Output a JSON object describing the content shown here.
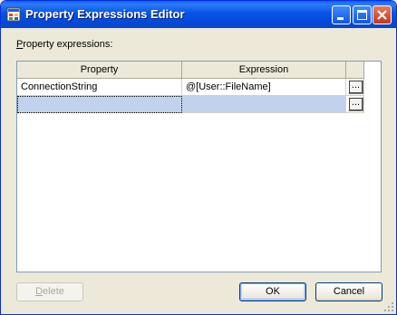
{
  "window": {
    "title": "Property Expressions Editor",
    "app_icon": "dialog-app-icon",
    "controls": [
      "minimize-icon",
      "maximize-icon",
      "close-icon"
    ]
  },
  "label": {
    "accel": "P",
    "rest": "roperty expressions:"
  },
  "grid": {
    "columns": [
      "Property",
      "Expression",
      ""
    ],
    "rows": [
      {
        "property": "ConnectionString",
        "expression": "@[User::FileName]",
        "button": "..."
      },
      {
        "property": "",
        "expression": "",
        "button": "..."
      }
    ]
  },
  "buttons": {
    "delete_accel": "D",
    "delete_rest": "elete",
    "ok": "OK",
    "cancel": "Cancel"
  },
  "colors": {
    "titlebar": "#0853e6",
    "dialog_bg": "#ece9d8",
    "selection": "#c1d2ee",
    "grid_border": "#7f9db9"
  }
}
